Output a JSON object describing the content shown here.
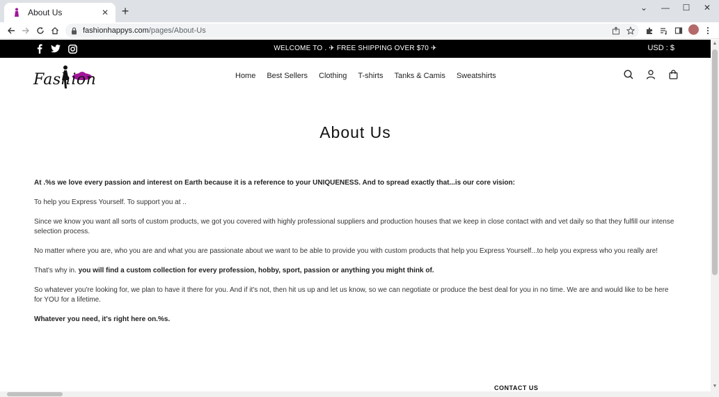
{
  "browser": {
    "tab_title": "About Us",
    "url_host": "fashionhappys.com",
    "url_path": "/pages/About-Us",
    "new_tab_glyph": "+",
    "close_glyph": "✕",
    "minimize_glyph": "—",
    "maximize_glyph": "☐",
    "window_close_glyph": "✕",
    "chevron_glyph": "⌄"
  },
  "announcement": {
    "text": "WELCOME TO . ✈ FREE SHIPPING OVER $70 ✈",
    "currency": "USD : $",
    "social": [
      "facebook-icon",
      "twitter-icon",
      "instagram-icon"
    ]
  },
  "header": {
    "logo_text": "Fashion",
    "nav": [
      "Home",
      "Best Sellers",
      "Clothing",
      "T-shirts",
      "Tanks & Camis",
      "Sweatshirts"
    ]
  },
  "main": {
    "title": "About Us",
    "p1": "At .%s we love every passion and interest on Earth because it is a reference to your UNIQUENESS. And to spread exactly that...is our core vision:",
    "p2": "To help you Express Yourself. To support you at ..",
    "p3": "Since we know you want all sorts of custom products, we got you covered with highly professional suppliers and production houses that we keep in close contact with and vet daily so that they fulfill our intense selection process.",
    "p4": "No matter where you are, who you are and what you are passionate about we want to be able to provide you with custom products that help you Express Yourself...to help you express who you really are!",
    "p5_plain": "That's why in. ",
    "p5_bold": "you will find a custom collection for every profession, hobby, sport, passion or anything you might think of.",
    "p6": "So whatever you're looking for, we plan to have it there for you. And if it's not, then hit us up and let us know, so we can negotiate or produce the best deal for you in no time. We are and would like to be here for YOU for a lifetime.",
    "p7": "Whatever you need, it's right here on.%s."
  },
  "footer": {
    "contact_heading": "CONTACT US"
  },
  "colors": {
    "logo_accent": "#a2169a",
    "announcement_bg": "#000000"
  }
}
